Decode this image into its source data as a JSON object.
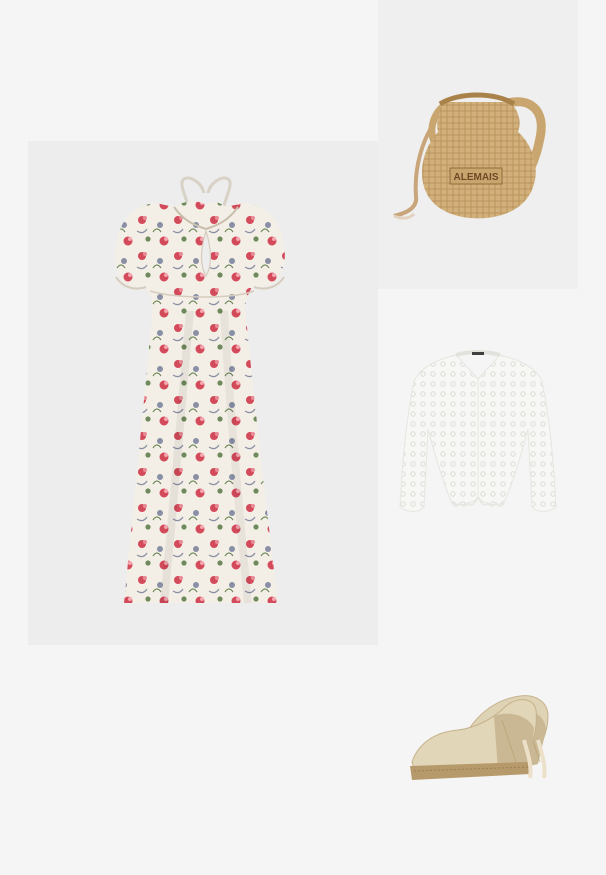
{
  "collage": {
    "background": "#f5f5f5",
    "items": [
      {
        "id": "floral-maxi-dress",
        "kind": "dress",
        "colors": [
          "#f4efe6",
          "#d34a5a",
          "#8a8fa6",
          "#6f8a5c"
        ]
      },
      {
        "id": "woven-straw-bag",
        "kind": "bag",
        "brand_label": "ALEMAIS",
        "colors": [
          "#d2b07c",
          "#b48c55",
          "#e8d7c2"
        ]
      },
      {
        "id": "crochet-cardigan",
        "kind": "cardigan",
        "colors": [
          "#f7f7f5",
          "#e4e4e0"
        ]
      },
      {
        "id": "espadrille-wedges",
        "kind": "shoes",
        "colors": [
          "#e2d6b8",
          "#b79a6b",
          "#c9b893"
        ]
      }
    ]
  }
}
